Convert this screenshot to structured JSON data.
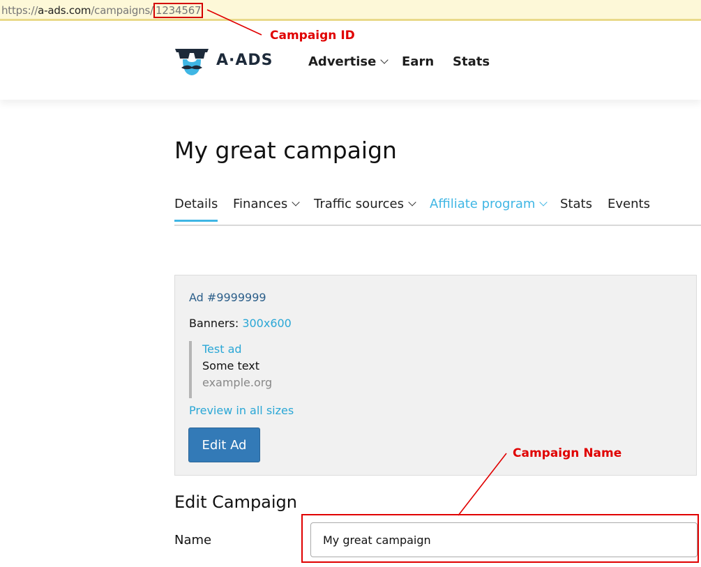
{
  "url": {
    "scheme": "https://",
    "host": "a-ads.com",
    "path": "/campaigns/",
    "campaign_id": "1234567"
  },
  "annotations": {
    "campaign_id_label": "Campaign ID",
    "campaign_name_label": "Campaign Name",
    "color": "#e00000"
  },
  "header": {
    "brand": "A·ADS",
    "nav": [
      {
        "label": "Advertise",
        "has_dropdown": true
      },
      {
        "label": "Earn",
        "has_dropdown": false
      },
      {
        "label": "Stats",
        "has_dropdown": false
      }
    ]
  },
  "page": {
    "title": "My great campaign",
    "tabs": [
      {
        "label": "Details",
        "active": true
      },
      {
        "label": "Finances",
        "dropdown": true
      },
      {
        "label": "Traffic sources",
        "dropdown": true
      },
      {
        "label": "Affiliate program",
        "dropdown": true,
        "highlighted": true
      },
      {
        "label": "Stats"
      },
      {
        "label": "Events"
      }
    ]
  },
  "ad": {
    "id_text": "Ad #9999999",
    "banners_label": "Banners:",
    "banners_size": "300x600",
    "preview": {
      "title": "Test ad",
      "text": "Some text",
      "url": "example.org"
    },
    "preview_link": "Preview in all sizes",
    "edit_button": "Edit Ad"
  },
  "edit_campaign": {
    "title": "Edit Campaign",
    "name_label": "Name",
    "name_value": "My great campaign"
  },
  "colors": {
    "accent": "#3fb6e4",
    "button": "#337ab7",
    "brand_dark": "#1d2a3a"
  }
}
